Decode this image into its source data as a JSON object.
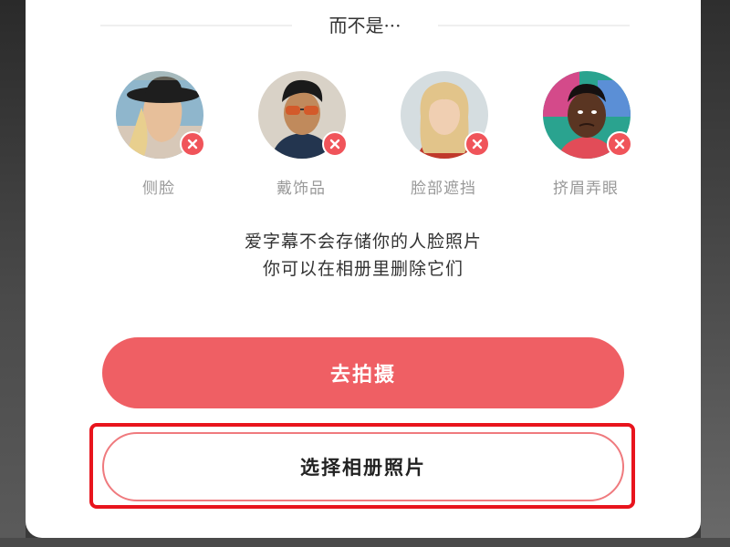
{
  "section_title": "而不是···",
  "examples": [
    {
      "label": "侧脸",
      "icon": "remove-x-icon"
    },
    {
      "label": "戴饰品",
      "icon": "remove-x-icon"
    },
    {
      "label": "脸部遮挡",
      "icon": "remove-x-icon"
    },
    {
      "label": "挤眉弄眼",
      "icon": "remove-x-icon"
    }
  ],
  "privacy_notice": {
    "line1": "爱字幕不会存储你的人脸照片",
    "line2": "你可以在相册里删除它们"
  },
  "buttons": {
    "take_photo": "去拍摄",
    "choose_album": "选择相册照片"
  },
  "colors": {
    "accent": "#ef5f64",
    "badge": "#f0545a",
    "highlight": "#e8141d"
  }
}
